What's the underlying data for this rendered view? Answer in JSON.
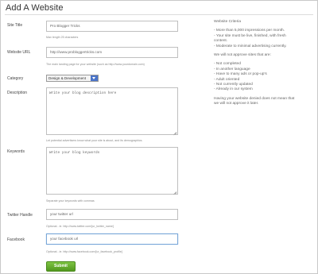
{
  "page": {
    "title": "Add A Website"
  },
  "form": {
    "site_title": {
      "label": "Site Title",
      "value": "Pro Blogger Tricks",
      "help": "Max length 25 characters"
    },
    "website_url": {
      "label": "Website URL",
      "value": "http://www.probloggertricks.com",
      "help": "The main landing page for your website (such as http://www.yourdomain.com)"
    },
    "category": {
      "label": "Category",
      "value": "Design & Development"
    },
    "description": {
      "label": "Description",
      "value": "Write your blog description here",
      "help": "Let potential advertisers know what your site is about, and its demographics."
    },
    "keywords": {
      "label": "Keywords",
      "value": "Write your blog keywords",
      "help": "Separate your keywords with commas"
    },
    "twitter": {
      "label": "Twitter Handle",
      "value": "your twitter url",
      "help": "Optional - ie. http://www.twitter.com/[ur_twitter_name]"
    },
    "facebook": {
      "label": "Facebook",
      "value": "your facebook url",
      "help": "Optional - ie. http://www.facebook.com/[ur_facebook_profile]"
    },
    "submit_label": "Submit"
  },
  "sidebar": {
    "criteria_title": "Website Criteria",
    "criteria": [
      "- More than 5,000 impressions per month.",
      "- Your site must be live, finished, with fresh",
      "  content.",
      "- Moderate to minimal advertising currently."
    ],
    "reject_title": "We will not approve sites that are:",
    "reject": [
      "- Not completed",
      "- In another language",
      "- Have to many ads or pop-up's",
      "- Adult oriented",
      "- Not currently updated",
      "- Already in our system"
    ],
    "note_line1": "Having your website denied does not mean that",
    "note_line2": "we will not approve it later."
  }
}
